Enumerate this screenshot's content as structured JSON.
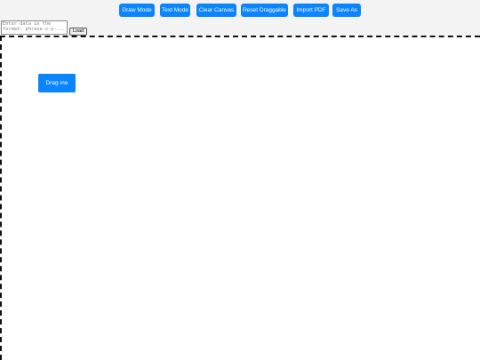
{
  "toolbar": {
    "buttons": [
      {
        "label": "Draw Mode"
      },
      {
        "label": "Text Mode"
      },
      {
        "label": "Clear Canvas"
      },
      {
        "label": "Reset Draggable"
      },
      {
        "label": "Import PDF"
      },
      {
        "label": "Save As"
      }
    ],
    "data_input": {
      "value": "",
      "placeholder": "Enter data in the format: phrase-x-y-..."
    },
    "load_label": "Load"
  },
  "canvas": {
    "draggable_label": "Drag me"
  },
  "colors": {
    "accent": "#0a84ff",
    "toolbar_background": "#f3f3f3",
    "canvas_border": "#111111"
  }
}
